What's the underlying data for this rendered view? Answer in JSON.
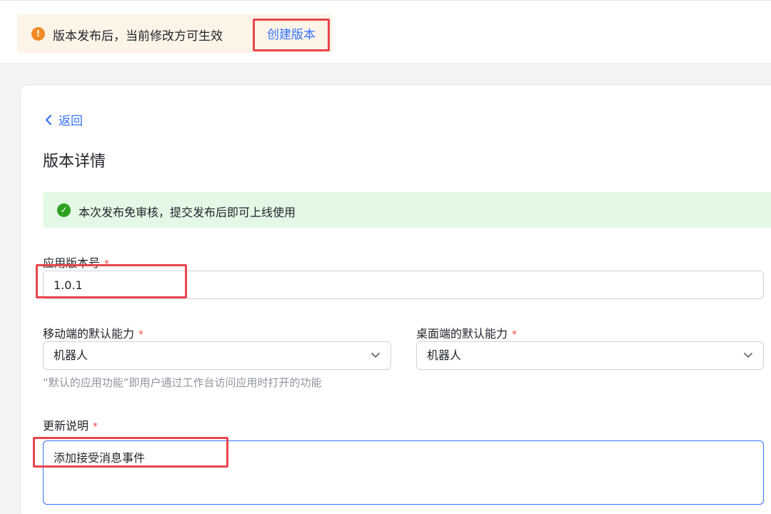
{
  "notice": {
    "icon": "warning-icon",
    "text": "版本发布后，当前修改方可生效",
    "action_label": "创建版本",
    "accent": "#f08a24"
  },
  "page": {
    "back_label": "返回",
    "title": "版本详情"
  },
  "success": {
    "icon": "check-circle-icon",
    "text": "本次发布免审核，提交发布后即可上线使用",
    "color": "#2ea121"
  },
  "form": {
    "version": {
      "label": "应用版本号",
      "required_mark": "*",
      "value": "1.0.1"
    },
    "mobile_default": {
      "label": "移动端的默认能力",
      "required_mark": "*",
      "value": "机器人"
    },
    "desktop_default": {
      "label": "桌面端的默认能力",
      "required_mark": "*",
      "value": "机器人"
    },
    "default_hint": "“默认的应用功能”即用户通过工作台访问应用时打开的功能",
    "update_notes": {
      "label": "更新说明",
      "required_mark": "*",
      "value": "添加接受消息事件"
    }
  },
  "colors": {
    "link": "#3370ff",
    "highlight": "#e8454d",
    "required": "#f54a45"
  }
}
